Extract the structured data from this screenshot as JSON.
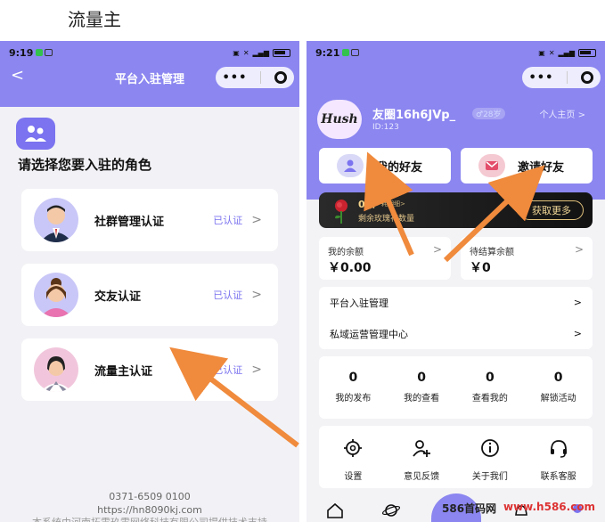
{
  "caption": "流量主",
  "left": {
    "status_time": "9:19",
    "nav_title": "平台入驻管理",
    "back_symbol": "<",
    "capsule_more": "•••",
    "prompt": "请选择您要入驻的角色",
    "roles": [
      {
        "label": "社群管理认证",
        "status": "已认证"
      },
      {
        "label": "交友认证",
        "status": "已认证"
      },
      {
        "label": "流量主认证",
        "status": "已认证"
      }
    ],
    "chevron": ">",
    "footer_phone": "0371-6509 0100",
    "footer_url": "https://hn8090kj.com",
    "footer_notice": "本系统由河南拓零玖零网络科技有限公司提供技术支持"
  },
  "right": {
    "status_time": "9:21",
    "capsule_more": "•••",
    "avatar_text": "Hush",
    "username": "友圈16h6JVp_",
    "age_badge": "♂28岁",
    "user_id": "ID:123",
    "homepage": "个人主页 >",
    "btn_friends": "我的好友",
    "btn_invite": "邀请好友",
    "roses_amount": "0朵",
    "roses_hint": "耗明细>",
    "roses_label": "剩余玫瑰花数量",
    "roses_button": "获取更多",
    "balance_label": "我的余额",
    "balance_value": "￥0.00",
    "pending_label": "待结算余额",
    "pending_value": "￥0",
    "menu": [
      {
        "label": "平台入驻管理"
      },
      {
        "label": "私域运营管理中心"
      }
    ],
    "chevron": ">",
    "stats": [
      {
        "value": "0",
        "label": "我的发布"
      },
      {
        "value": "0",
        "label": "我的查看"
      },
      {
        "value": "0",
        "label": "查看我的"
      },
      {
        "value": "0",
        "label": "解锁活动"
      }
    ],
    "tools": [
      {
        "label": "设置",
        "icon": "gear-icon"
      },
      {
        "label": "意见反馈",
        "icon": "add-user-icon"
      },
      {
        "label": "关于我们",
        "icon": "info-icon"
      },
      {
        "label": "联系客服",
        "icon": "headset-icon"
      }
    ]
  },
  "watermark_a": "586首码网",
  "watermark_b": "www.h586.com",
  "colors": {
    "accent": "#8b86f0",
    "purple": "#7b73ef",
    "arrow": "#f08a3c"
  }
}
